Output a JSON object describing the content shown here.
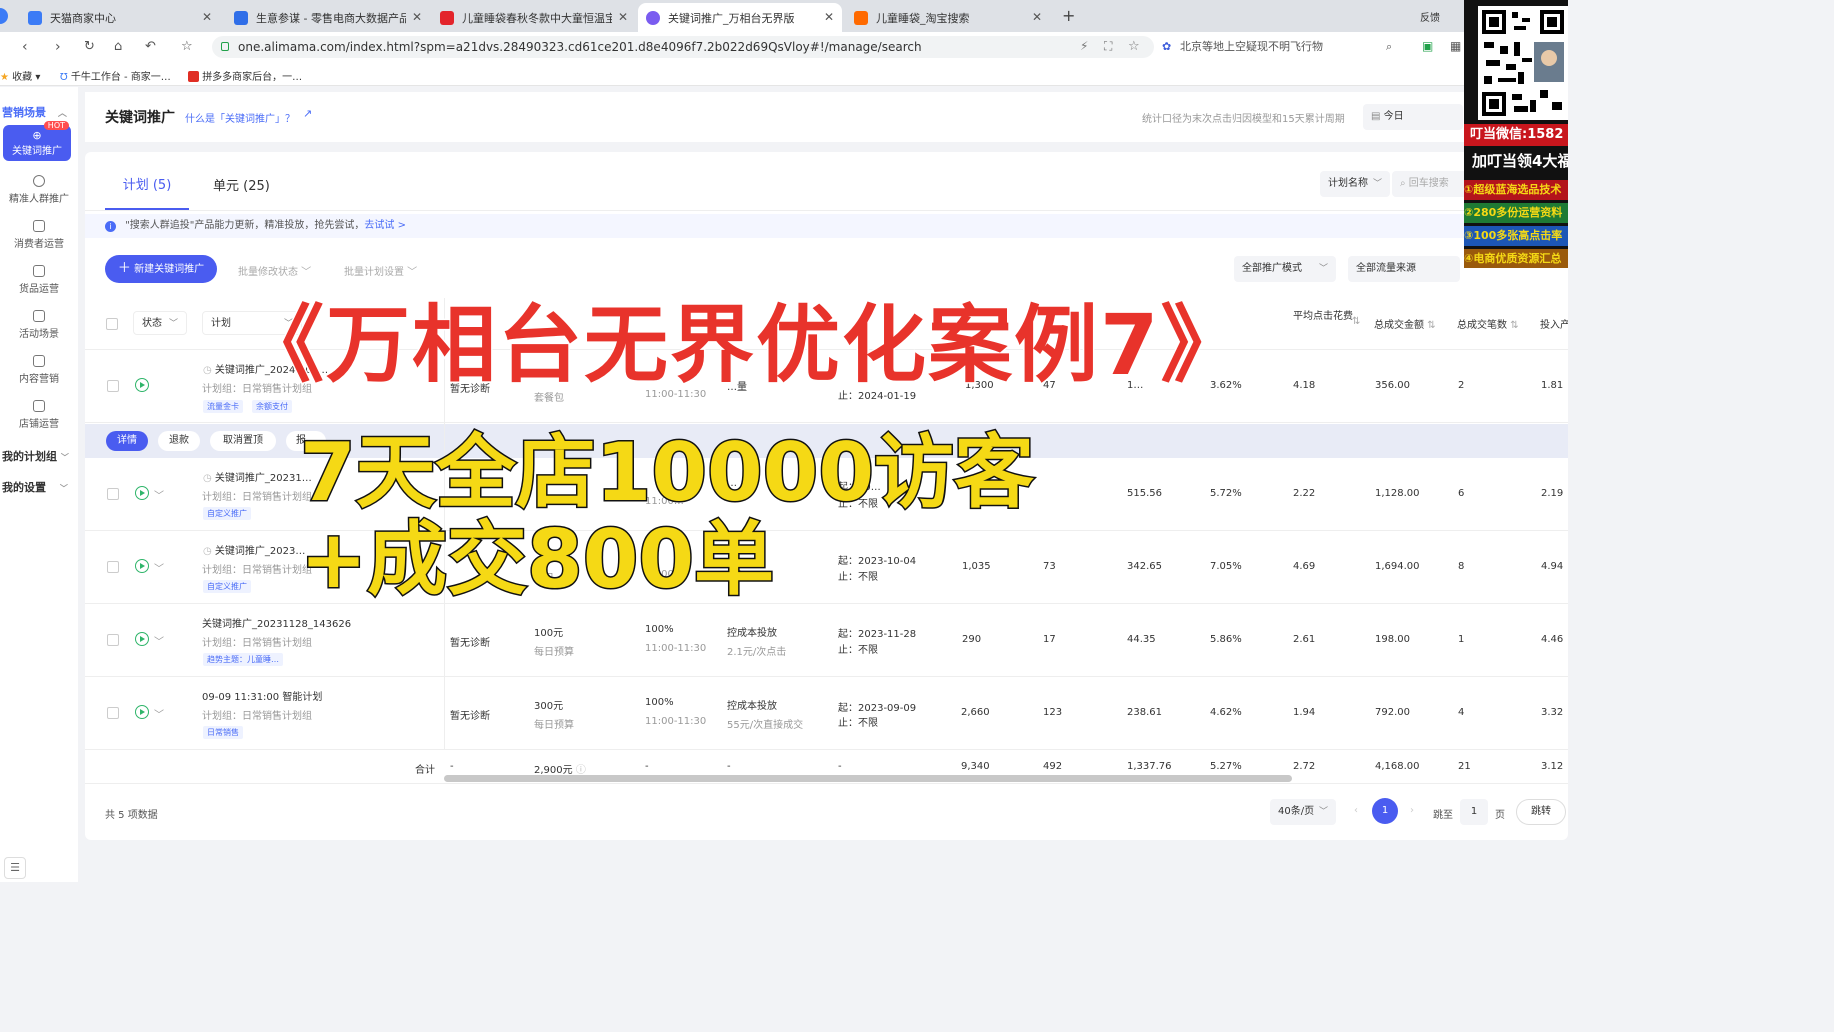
{
  "browser": {
    "tabs": [
      {
        "label": "天猫商家中心",
        "color": "#3b7bf6"
      },
      {
        "label": "生意参谋 - 零售电商大数据产品",
        "color": "#2f6ee8"
      },
      {
        "label": "儿童睡袋春秋冬款中大童恒温宝",
        "color": "#e3242b"
      },
      {
        "label": "关键词推广_万相台无界版",
        "color": "#7a5cf0"
      },
      {
        "label": "儿童睡袋_淘宝搜索",
        "color": "#ff6a00"
      }
    ],
    "new_tab": "+",
    "feedback": "反馈",
    "url": "one.alimama.com/index.html?spm=a21dvs.28490323.cd61ce201.d8e4096f7.2b022d69QsVloy#!/manage/search",
    "search_box": "北京等地上空疑现不明飞行物",
    "bookmarks": [
      "收藏",
      "千牛工作台 - 商家一…",
      "拼多多商家后台，一…"
    ]
  },
  "sidebar": {
    "section": "营销场景",
    "active": {
      "label": "关键词推广",
      "badge": "HOT"
    },
    "items": [
      "精准人群推广",
      "消费者运营",
      "货品运营",
      "活动场景",
      "内容营销",
      "店铺运营"
    ],
    "groups": [
      "我的计划组",
      "我的设置"
    ]
  },
  "header": {
    "title": "关键词推广",
    "help_link": "什么是「关键词推广」？",
    "stat_note": "统计口径为末次点击归因模型和15天累计周期",
    "date": "今日"
  },
  "tabs": {
    "plan": "计划 (5)",
    "unit": "单元 (25)"
  },
  "filters": {
    "name_select": "计划名称",
    "search_placeholder": "回车搜索",
    "mode": "全部推广模式",
    "source": "全部流量来源"
  },
  "notice": {
    "text": "\"搜索人群追投\"产品能力更新，精准投放，抢先尝试，",
    "link": "去试试 >"
  },
  "toolbar": {
    "new_button": "新建关键词推广",
    "batch_status": "批量修改状态",
    "batch_plan": "批量计划设置"
  },
  "table": {
    "headers": {
      "status": "状态",
      "plan": "计划",
      "avg_cpc": "平均点击花费",
      "gmv": "总成交金额",
      "orders": "总成交笔数",
      "roi": "投入产"
    },
    "rows": [
      {
        "name": "关键词推广_2024…01…",
        "group": "计划组：日常销售计划组",
        "tags": [
          "流量金卡",
          "余额支付"
        ],
        "diag": "暂无诊断",
        "budget_sub": "套餐包",
        "time": "11:00-11:30",
        "bid": "…量",
        "end": "止：2024-01-19",
        "pv": "1,300",
        "clk": "47",
        "cost": "1…",
        "ctr": "3.62%",
        "cpc": "4.18",
        "gmv": "356.00",
        "orders": "2",
        "roi": "1.81"
      },
      {
        "name": "关键词推广_20231…",
        "group": "计划组：日常销售计划组",
        "tags": [
          "自定义推广"
        ],
        "diag": "",
        "budget_sub": "",
        "time": "11:00…",
        "bid": "…",
        "start": "起：20…",
        "end": "止：不限",
        "pv": "",
        "clk": "",
        "cost": "515.56",
        "ctr": "5.72%",
        "cpc": "2.22",
        "gmv": "1,128.00",
        "orders": "6",
        "roi": "2.19"
      },
      {
        "name": "关键词推广_2023…",
        "group": "计划组：日常销售计划组",
        "tags": [
          "自定义推广"
        ],
        "diag": "",
        "budget_sub": "每日…",
        "time": "11:00…",
        "bid": "2.1…",
        "start": "起：2023-10-04",
        "end": "止：不限",
        "pv": "1,035",
        "clk": "73",
        "cost": "342.65",
        "ctr": "7.05%",
        "cpc": "4.69",
        "gmv": "1,694.00",
        "orders": "8",
        "roi": "4.94"
      },
      {
        "name": "关键词推广_20231128_143626",
        "group": "计划组：日常销售计划组",
        "tags": [
          "趋势主题：儿童睡…"
        ],
        "diag": "暂无诊断",
        "budget": "100元",
        "budget_sub": "每日预算",
        "rate": "100%",
        "time": "11:00-11:30",
        "bid": "控成本投放",
        "bid_sub": "2.1元/次点击",
        "start": "起：2023-11-28",
        "end": "止：不限",
        "pv": "290",
        "clk": "17",
        "cost": "44.35",
        "ctr": "5.86%",
        "cpc": "2.61",
        "gmv": "198.00",
        "orders": "1",
        "roi": "4.46"
      },
      {
        "name": "09-09 11:31:00 智能计划",
        "group": "计划组：日常销售计划组",
        "tags": [
          "日常销售"
        ],
        "diag": "暂无诊断",
        "budget": "300元",
        "budget_sub": "每日预算",
        "rate": "100%",
        "time": "11:00-11:30",
        "bid": "控成本投放",
        "bid_sub": "55元/次直接成交",
        "start": "起：2023-09-09",
        "end": "止：不限",
        "pv": "2,660",
        "clk": "123",
        "cost": "238.61",
        "ctr": "4.62%",
        "cpc": "1.94",
        "gmv": "792.00",
        "orders": "4",
        "roi": "3.32"
      }
    ],
    "row_actions": [
      "详情",
      "退款",
      "取消置顶",
      "报…"
    ],
    "total": {
      "label": "合计",
      "diag": "-",
      "budget": "2,900元",
      "rate": "-",
      "bid": "-",
      "start": "-",
      "pv": "9,340",
      "clk": "492",
      "cost": "1,337.76",
      "ctr": "5.27%",
      "cpc": "2.72",
      "gmv": "4,168.00",
      "orders": "21",
      "roi": "3.12"
    }
  },
  "pagination": {
    "count": "共 5 项数据",
    "per_page": "40条/页",
    "current": "1",
    "goto": "跳至",
    "page_input": "1",
    "page_unit": "页",
    "jump": "跳转"
  },
  "overlay": {
    "title": "《万相台无界优化案例7》",
    "line1": "7天全店10000访客",
    "line2": "+成交800单"
  },
  "promo": {
    "wechat": "叮当微信:1582",
    "join": "加叮当领4大福",
    "items": [
      "①超级蓝海选品技术",
      "②280多份运营资料",
      "③100多张高点击率",
      "④电商优质资源汇总"
    ]
  }
}
